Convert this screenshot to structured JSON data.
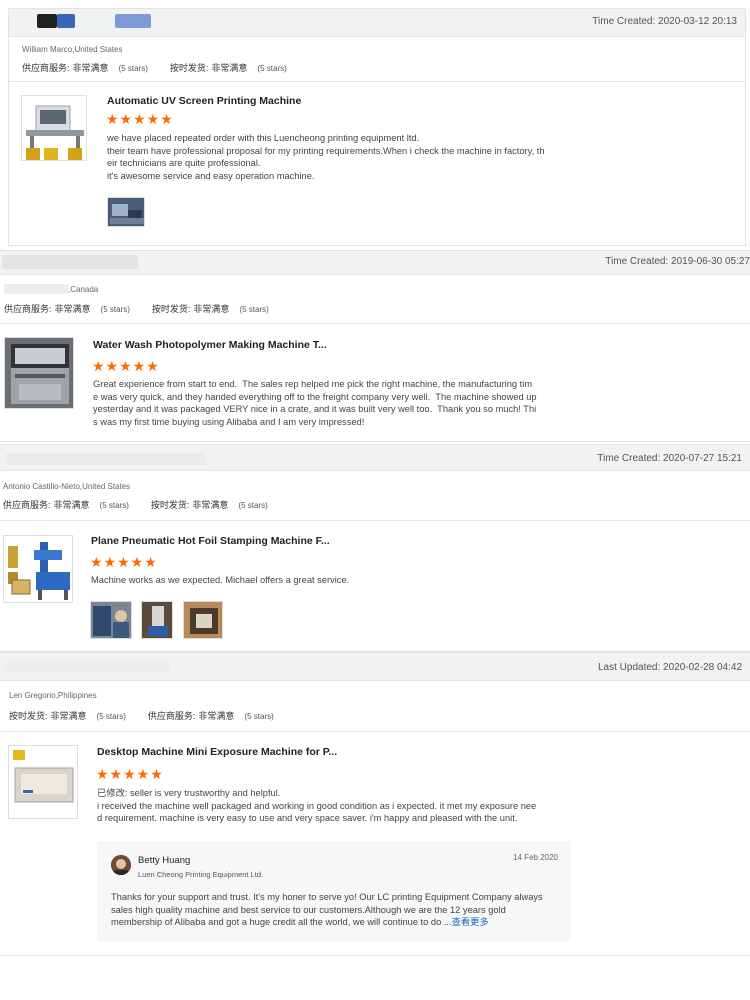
{
  "reviews": [
    {
      "time": "Time Created: 2020-03-12 20:13",
      "buyer": "William Marco,United States",
      "ratings": [
        {
          "label": "供应商服务:",
          "value": "非常满意",
          "count": "(5 stars)"
        },
        {
          "label": "按时发货:",
          "value": "非常满意",
          "count": "(5 stars)"
        }
      ],
      "product": "Automatic UV Screen Printing Machine",
      "stars": "★★★★★",
      "text": "we have placed repeated order with this Luencheong printing equipment ltd.\ntheir team have professional proposal for my printing requirements.When i check the machine in factory, th\neir technicians are quite professional.\nit's awesome service and easy operation machine."
    },
    {
      "time": "Time Created: 2019-06-30 05:27",
      "buyer": ",Canada",
      "ratings": [
        {
          "label": "供应商服务:",
          "value": "非常满意",
          "count": "(5 stars)"
        },
        {
          "label": "按时发货:",
          "value": "非常满意",
          "count": "(5 stars)"
        }
      ],
      "product": "Water Wash Photopolymer Making Machine T...",
      "stars": "★★★★★",
      "text": "Great experience from start to end.  The sales rep helped me pick the right machine, the manufacturing tim\ne was very quick, and they handed everything off to the freight company very well.  The machine showed up\nyesterday and it was packaged VERY nice in a crate, and it was built very well too.  Thank you so much! Thi\ns was my first time buying using Alibaba and I am very impressed!"
    },
    {
      "time": "Time Created: 2020-07-27 15:21",
      "buyer": "Antonio Castillo-Nieto,United States",
      "ratings": [
        {
          "label": "供应商服务:",
          "value": "非常满意",
          "count": "(5 stars)"
        },
        {
          "label": "按时发货:",
          "value": "非常满意",
          "count": "(5 stars)"
        }
      ],
      "product": "Plane Pneumatic Hot Foil Stamping Machine F...",
      "stars": "★★★★★",
      "text": "Machine works as we expected. Michael offers a great service."
    },
    {
      "time": "Last Updated: 2020-02-28 04:42",
      "buyer": "Len Gregorio,Philippines",
      "ratings": [
        {
          "label": "按时发货:",
          "value": "非常满意",
          "count": "(5 stars)"
        },
        {
          "label": "供应商服务:",
          "value": "非常满意",
          "count": "(5 stars)"
        }
      ],
      "product": "Desktop Machine Mini Exposure Machine for P...",
      "stars": "★★★★★",
      "text_prefix": "已修改:",
      "text": "seller is very trustworthy and helpful.\ni received the machine well packaged and working in good condition as i expected. it met my exposure nee\nd requirement. machine is very easy to use and very space saver. i'm happy and pleased with the unit.",
      "reply": {
        "name": "Betty Huang",
        "company": "Luen Cheong Printing Equipment Ltd.",
        "date": "14 Feb 2020",
        "text": "Thanks for your support and trust. It's my honer to serve yo! Our LC printing Equipment Company always\nsales high quality machine and best service to our customers.Although we are the 12 years gold\nmembership of Alibaba and got a huge credit all the world, we will continue to do ...",
        "more": "查看更多"
      }
    }
  ],
  "icons": {
    "star": "star-icon"
  },
  "colors": {
    "star": "#ff6a00",
    "link": "#1a66c9"
  }
}
